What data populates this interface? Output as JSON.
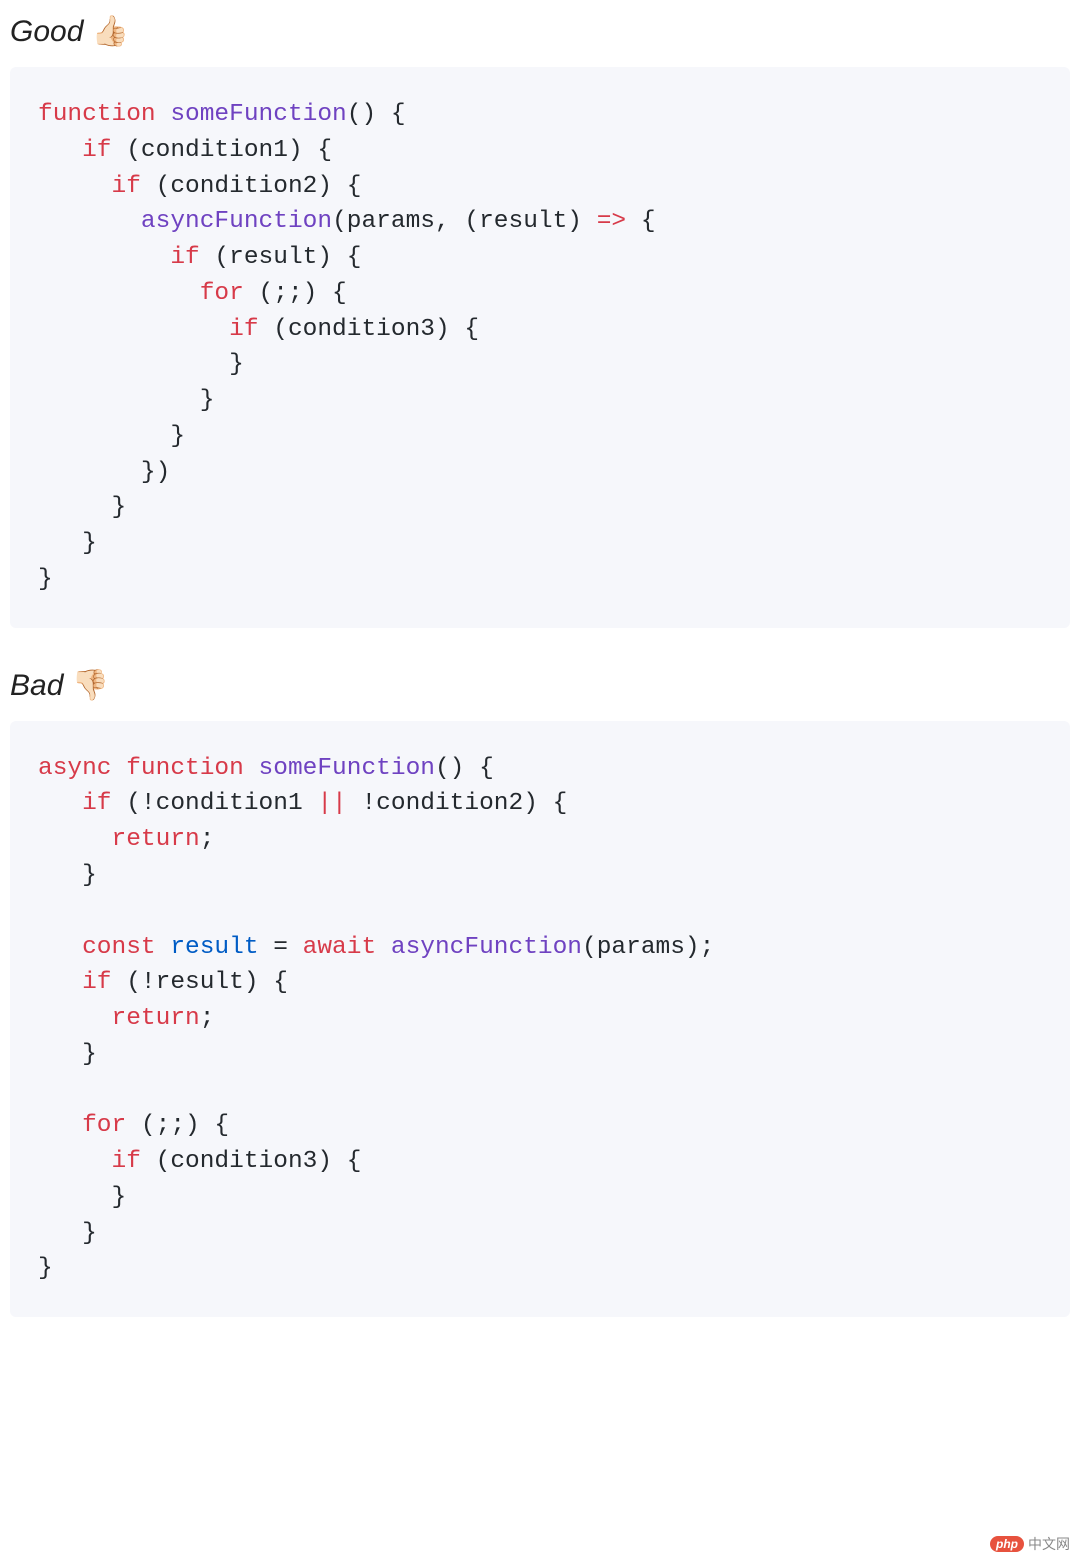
{
  "good": {
    "label": "Good",
    "emoji": "👍🏻",
    "code": {
      "l1": {
        "kw1": "function",
        "fn": "someFunction",
        "after": "() {"
      },
      "l2": {
        "indent": "   ",
        "kw": "if",
        "after": " (condition1) {"
      },
      "l3": {
        "indent": "     ",
        "kw": "if",
        "after": " (condition2) {"
      },
      "l4": {
        "indent": "       ",
        "fn": "asyncFunction",
        "mid": "(params, (result) ",
        "arrow": "=>",
        "after": " {"
      },
      "l5": {
        "indent": "         ",
        "kw": "if",
        "after": " (result) {"
      },
      "l6": {
        "indent": "           ",
        "kw": "for",
        "after": " (;;) {"
      },
      "l7": {
        "indent": "             ",
        "kw": "if",
        "after": " (condition3) {"
      },
      "l8": {
        "indent": "             ",
        "text": "}"
      },
      "l9": {
        "indent": "           ",
        "text": "}"
      },
      "l10": {
        "indent": "         ",
        "text": "}"
      },
      "l11": {
        "indent": "       ",
        "text": "})"
      },
      "l12": {
        "indent": "     ",
        "text": "}"
      },
      "l13": {
        "indent": "   ",
        "text": "}"
      },
      "l14": {
        "indent": "",
        "text": "}"
      }
    }
  },
  "bad": {
    "label": "Bad",
    "emoji": "👎🏻",
    "code": {
      "l1": {
        "kw1": "async",
        "kw2": "function",
        "fn": "someFunction",
        "after": "() {"
      },
      "l2": {
        "indent": "   ",
        "kw": "if",
        "mid": " (!condition1 ",
        "op": "||",
        "after": " !condition2) {"
      },
      "l3": {
        "indent": "     ",
        "kw": "return",
        "after": ";"
      },
      "l4": {
        "indent": "   ",
        "text": "}"
      },
      "blank1": "",
      "l5": {
        "indent": "   ",
        "kw": "const",
        "var": "result",
        "mid": " = ",
        "kw2": "await",
        "sp": " ",
        "fn": "asyncFunction",
        "after": "(params);"
      },
      "l6": {
        "indent": "   ",
        "kw": "if",
        "after": " (!result) {"
      },
      "l7": {
        "indent": "     ",
        "kw": "return",
        "after": ";"
      },
      "l8": {
        "indent": "   ",
        "text": "}"
      },
      "blank2": "",
      "l9": {
        "indent": "   ",
        "kw": "for",
        "after": " (;;) {"
      },
      "l10": {
        "indent": "     ",
        "kw": "if",
        "after": " (condition3) {"
      },
      "l11": {
        "indent": "     ",
        "text": "}"
      },
      "l12": {
        "indent": "   ",
        "text": "}"
      },
      "l13": {
        "indent": "",
        "text": "}"
      }
    }
  },
  "watermark": {
    "logo": "php",
    "text": "中文网"
  }
}
